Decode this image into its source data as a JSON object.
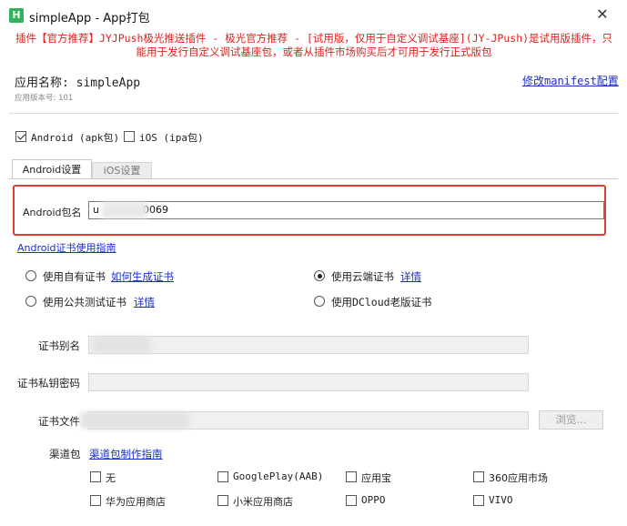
{
  "window": {
    "title": "simpleApp - App打包",
    "icon_letter": "H",
    "close_glyph": "✕"
  },
  "warning": {
    "line1": "插件【官方推荐】JYJPush极光推送插件 - 极光官方推荐 - [试用版，仅用于自定义调试基座](JY-JPush)是试用版插件，只",
    "line2": "能用于发行自定义调试基座包，或者从插件市场购买后才可用于发行正式版包"
  },
  "app": {
    "name_text": "应用名称: simpleApp",
    "version_text": "应用版本号: 101",
    "edit_manifest_label": "修改manifest配置"
  },
  "platforms": {
    "android_label": "Android (apk包)",
    "ios_label": "iOS (ipa包)"
  },
  "tabs": {
    "android": "Android设置",
    "ios": "iOS设置"
  },
  "package": {
    "label": "Android包名",
    "value_prefix": "u",
    "value_suffix": "0069"
  },
  "cert_guide_label": "Android证书使用指南",
  "cert_options": {
    "own": "使用自有证书",
    "own_link": "如何生成证书",
    "cloud": "使用云端证书",
    "cloud_link": "详情",
    "public_test": "使用公共测试证书",
    "public_test_link": "详情",
    "dcloud_old": "使用DCloud老版证书"
  },
  "fields": {
    "alias_label": "证书别名",
    "password_label": "证书私钥密码",
    "file_label": "证书文件",
    "browse_label": "浏览..."
  },
  "channels": {
    "label": "渠道包",
    "guide_link": "渠道包制作指南",
    "items": [
      "无",
      "GooglePlay(AAB)",
      "应用宝",
      "360应用市场",
      "华为应用商店",
      "小米应用商店",
      "OPPO",
      "VIVO"
    ]
  },
  "colors": {
    "warning": "#e0201b",
    "link": "#1a2fc4",
    "highlight_box": "#e33a33",
    "app_icon": "#2fb45a"
  }
}
